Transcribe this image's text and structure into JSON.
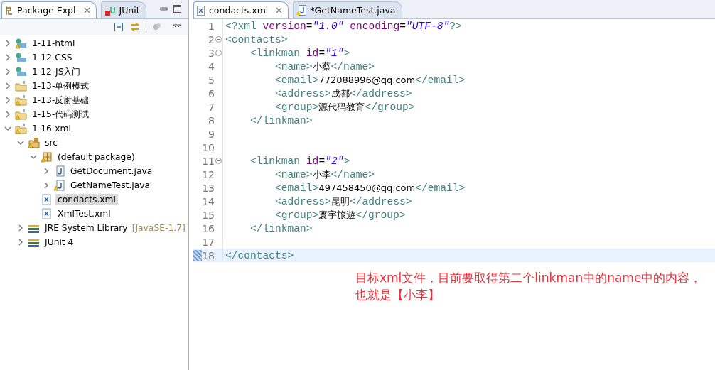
{
  "explorer": {
    "tabs": [
      {
        "label": "Package Expl",
        "kind": "package",
        "selected": true,
        "closable": true
      },
      {
        "label": "JUnit",
        "kind": "junit",
        "selected": false,
        "closable": false
      }
    ],
    "tree": [
      {
        "label": "1-11-html",
        "kind": "web",
        "warning": true,
        "expanded": false,
        "selected": false
      },
      {
        "label": "1-12-CSS",
        "kind": "web",
        "warning": false,
        "expanded": false,
        "selected": false
      },
      {
        "label": "1-12-JS入门",
        "kind": "web",
        "warning": false,
        "expanded": false,
        "selected": false
      },
      {
        "label": "1-13-单例模式",
        "kind": "project",
        "warning": false,
        "expanded": false,
        "selected": false
      },
      {
        "label": "1-13-反射基础",
        "kind": "project",
        "warning": true,
        "expanded": false,
        "selected": false
      },
      {
        "label": "1-15-代码测试",
        "kind": "project",
        "warning": true,
        "expanded": false,
        "selected": false
      },
      {
        "label": "1-16-xml",
        "kind": "project",
        "warning": true,
        "expanded": true,
        "selected": false,
        "children": [
          {
            "label": "src",
            "kind": "source",
            "warning": true,
            "expanded": true,
            "selected": false,
            "children": [
              {
                "label": "(default package)",
                "kind": "package",
                "warning": true,
                "expanded": true,
                "selected": false,
                "children": [
                  {
                    "label": "GetDocument.java",
                    "kind": "java",
                    "warning": false,
                    "expanded": false,
                    "selected": false
                  },
                  {
                    "label": "GetNameTest.java",
                    "kind": "java",
                    "warning": true,
                    "expanded": false,
                    "selected": false
                  }
                ]
              },
              {
                "label": "condacts.xml",
                "kind": "xml",
                "warning": false,
                "selected": true
              },
              {
                "label": "XmlTest.xml",
                "kind": "xml",
                "warning": false,
                "selected": false
              }
            ]
          },
          {
            "label": "JRE System Library",
            "suffix": "[JavaSE-1.7]",
            "kind": "library",
            "warning": false,
            "expanded": false,
            "selected": false
          },
          {
            "label": "JUnit 4",
            "kind": "library",
            "warning": false,
            "expanded": false,
            "selected": false
          }
        ]
      }
    ]
  },
  "editor": {
    "tabs": [
      {
        "label": "condacts.xml",
        "kind": "xml",
        "selected": true,
        "closable": true
      },
      {
        "label": "*GetNameTest.java",
        "kind": "java",
        "selected": false,
        "closable": false
      }
    ],
    "lines": [
      {
        "number": "1",
        "fold": false,
        "current": false,
        "tokens": [
          {
            "kind": "tag",
            "text": "<?xml"
          },
          {
            "kind": "attr",
            "text": " version"
          },
          {
            "kind": "plain",
            "text": "="
          },
          {
            "kind": "value",
            "text": "\"1.0\""
          },
          {
            "kind": "attr",
            "text": " encoding"
          },
          {
            "kind": "plain",
            "text": "="
          },
          {
            "kind": "value",
            "text": "\"UTF-8\""
          },
          {
            "kind": "tag",
            "text": "?>"
          }
        ]
      },
      {
        "number": "2",
        "fold": true,
        "current": false,
        "tokens": [
          {
            "kind": "tag",
            "text": "<contacts>"
          }
        ]
      },
      {
        "number": "3",
        "fold": true,
        "current": false,
        "tokens": [
          {
            "kind": "tag",
            "text": "    <linkman"
          },
          {
            "kind": "attr",
            "text": " id"
          },
          {
            "kind": "plain",
            "text": "="
          },
          {
            "kind": "value",
            "text": "\"1\""
          },
          {
            "kind": "tag",
            "text": ">"
          }
        ]
      },
      {
        "number": "4",
        "fold": false,
        "current": false,
        "tokens": [
          {
            "kind": "tag",
            "text": "        <name>"
          },
          {
            "kind": "text",
            "text": "小蔡"
          },
          {
            "kind": "tag",
            "text": "</name>"
          }
        ]
      },
      {
        "number": "5",
        "fold": false,
        "current": false,
        "tokens": [
          {
            "kind": "tag",
            "text": "        <email>"
          },
          {
            "kind": "text",
            "text": "772088996@qq.com"
          },
          {
            "kind": "tag",
            "text": "</email>"
          }
        ]
      },
      {
        "number": "6",
        "fold": false,
        "current": false,
        "tokens": [
          {
            "kind": "tag",
            "text": "        <address>"
          },
          {
            "kind": "text",
            "text": "成都"
          },
          {
            "kind": "tag",
            "text": "</address>"
          }
        ]
      },
      {
        "number": "7",
        "fold": false,
        "current": false,
        "tokens": [
          {
            "kind": "tag",
            "text": "        <group>"
          },
          {
            "kind": "text",
            "text": "源代码教育"
          },
          {
            "kind": "tag",
            "text": "</group>"
          }
        ]
      },
      {
        "number": "8",
        "fold": false,
        "current": false,
        "tokens": [
          {
            "kind": "tag",
            "text": "    </linkman>"
          }
        ]
      },
      {
        "number": "9",
        "fold": false,
        "current": false
      },
      {
        "number": "10",
        "fold": false,
        "current": false
      },
      {
        "number": "11",
        "fold": true,
        "current": false,
        "tokens": [
          {
            "kind": "tag",
            "text": "    <linkman"
          },
          {
            "kind": "attr",
            "text": " id"
          },
          {
            "kind": "plain",
            "text": "="
          },
          {
            "kind": "value",
            "text": "\"2\""
          },
          {
            "kind": "tag",
            "text": ">"
          }
        ]
      },
      {
        "number": "12",
        "fold": false,
        "current": false,
        "tokens": [
          {
            "kind": "tag",
            "text": "        <name>"
          },
          {
            "kind": "text",
            "text": "小李"
          },
          {
            "kind": "tag",
            "text": "</name>"
          }
        ]
      },
      {
        "number": "13",
        "fold": false,
        "current": false,
        "tokens": [
          {
            "kind": "tag",
            "text": "        <email>"
          },
          {
            "kind": "text",
            "text": "497458450@qq.com"
          },
          {
            "kind": "tag",
            "text": "</email>"
          }
        ]
      },
      {
        "number": "14",
        "fold": false,
        "current": false,
        "tokens": [
          {
            "kind": "tag",
            "text": "        <address>"
          },
          {
            "kind": "text",
            "text": "昆明"
          },
          {
            "kind": "tag",
            "text": "</address>"
          }
        ]
      },
      {
        "number": "15",
        "fold": false,
        "current": false,
        "tokens": [
          {
            "kind": "tag",
            "text": "        <group>"
          },
          {
            "kind": "text",
            "text": "寰宇旅遊"
          },
          {
            "kind": "tag",
            "text": "</group>"
          }
        ]
      },
      {
        "number": "16",
        "fold": false,
        "current": false,
        "tokens": [
          {
            "kind": "tag",
            "text": "    </linkman>"
          }
        ]
      },
      {
        "number": "17",
        "fold": false,
        "current": false
      },
      {
        "number": "18",
        "fold": false,
        "current": true,
        "tokens": [
          {
            "kind": "tag",
            "text": "</contacts>"
          }
        ]
      }
    ],
    "annotation": "目标xml文件，目前要取得第二个linkman中的name中的内容，也就是【小李】"
  }
}
